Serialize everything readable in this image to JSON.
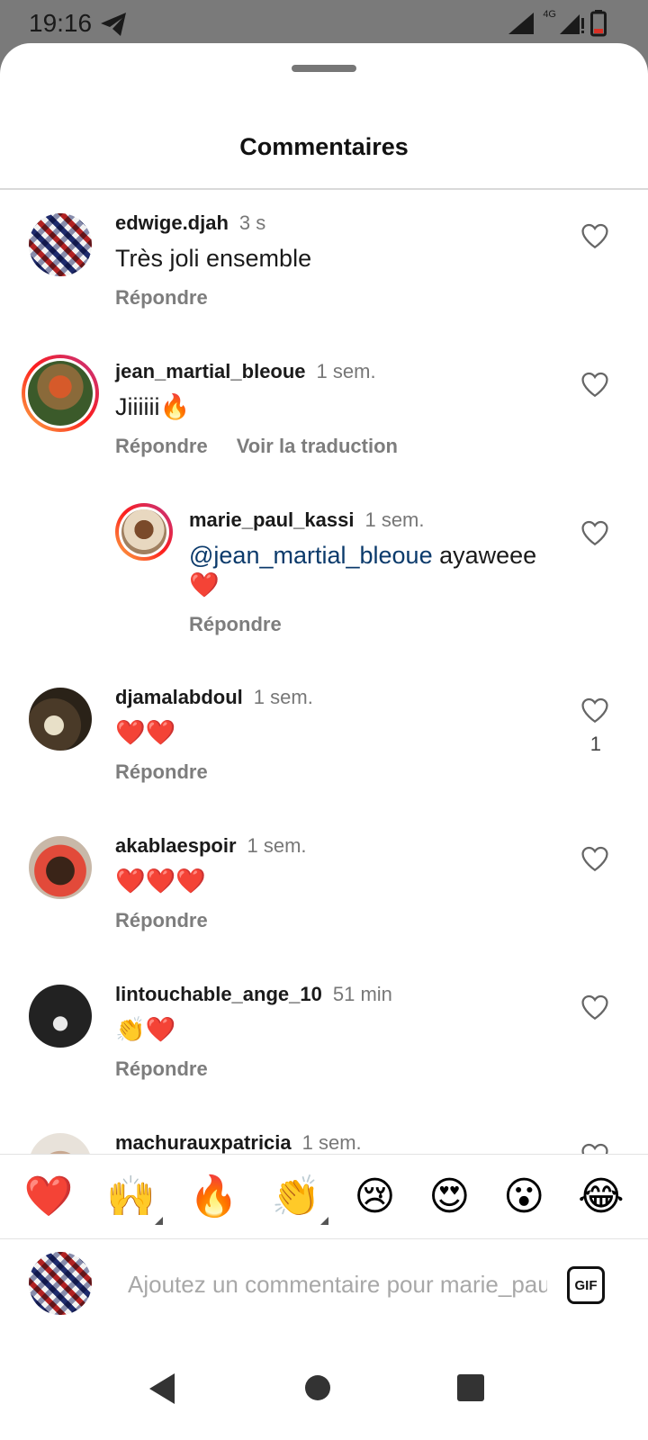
{
  "status_bar": {
    "time": "19:16",
    "network": "4G"
  },
  "sheet": {
    "title": "Commentaires"
  },
  "comments": [
    {
      "username": "edwige.djah",
      "time": "3 s",
      "text": "Très joli ensemble",
      "reply": "Répondre"
    },
    {
      "username": "jean_martial_bleoue",
      "time": "1 sem.",
      "text": "Jiiiiii🔥",
      "reply": "Répondre",
      "translate": "Voir la traduction"
    },
    {
      "username": "marie_paul_kassi",
      "time": "1 sem.",
      "mention": "@jean_martial_bleoue",
      "text": " ayaweee ❤️",
      "reply": "Répondre"
    },
    {
      "username": "djamalabdoul",
      "time": "1 sem.",
      "text": "❤️❤️",
      "reply": "Répondre",
      "likes": "1"
    },
    {
      "username": "akablaespoir",
      "time": "1 sem.",
      "text": "❤️❤️❤️",
      "reply": "Répondre"
    },
    {
      "username": "lintouchable_ange_10",
      "time": "51 min",
      "text": "👏❤️",
      "reply": "Répondre"
    },
    {
      "username": "machurauxpatricia",
      "time": "1 sem."
    }
  ],
  "reactions": [
    "❤️",
    "🙌",
    "🔥",
    "👏",
    "😢",
    "😍",
    "😮",
    "😂"
  ],
  "composer": {
    "placeholder": "Ajoutez un commentaire pour marie_paul_kassi...",
    "gif_label": "GIF"
  },
  "icons": {
    "like": "heart-outline-icon",
    "back": "back-triangle-icon",
    "home": "home-circle-icon",
    "recents": "recents-square-icon"
  }
}
